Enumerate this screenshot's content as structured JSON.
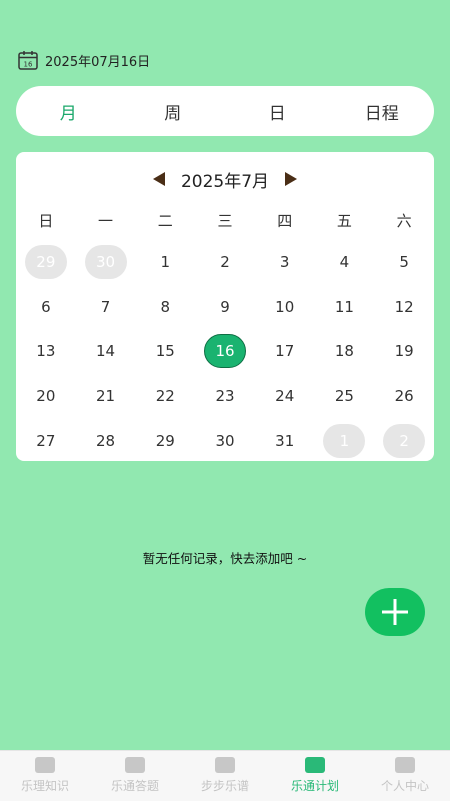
{
  "header": {
    "date": "2025年07月16日"
  },
  "view_tabs": [
    {
      "label": "月",
      "active": true
    },
    {
      "label": "周",
      "active": false
    },
    {
      "label": "日",
      "active": false
    },
    {
      "label": "日程",
      "active": false
    }
  ],
  "calendar": {
    "month_label": "2025年7月",
    "weekdays": [
      "日",
      "一",
      "二",
      "三",
      "四",
      "五",
      "六"
    ],
    "weeks": [
      [
        {
          "d": "29",
          "other": true
        },
        {
          "d": "30",
          "other": true
        },
        {
          "d": "1"
        },
        {
          "d": "2"
        },
        {
          "d": "3"
        },
        {
          "d": "4"
        },
        {
          "d": "5"
        }
      ],
      [
        {
          "d": "6"
        },
        {
          "d": "7"
        },
        {
          "d": "8"
        },
        {
          "d": "9"
        },
        {
          "d": "10"
        },
        {
          "d": "11"
        },
        {
          "d": "12"
        }
      ],
      [
        {
          "d": "13"
        },
        {
          "d": "14"
        },
        {
          "d": "15"
        },
        {
          "d": "16",
          "today": true
        },
        {
          "d": "17"
        },
        {
          "d": "18"
        },
        {
          "d": "19"
        }
      ],
      [
        {
          "d": "20"
        },
        {
          "d": "21"
        },
        {
          "d": "22"
        },
        {
          "d": "23"
        },
        {
          "d": "24"
        },
        {
          "d": "25"
        },
        {
          "d": "26"
        }
      ],
      [
        {
          "d": "27"
        },
        {
          "d": "28"
        },
        {
          "d": "29"
        },
        {
          "d": "30"
        },
        {
          "d": "31"
        },
        {
          "d": "1",
          "other": true
        },
        {
          "d": "2",
          "other": true
        }
      ]
    ]
  },
  "empty_message": "暂无任何记录，快去添加吧 ~",
  "bottom_nav": [
    {
      "label": "乐理知识",
      "icon": "music-theory-icon",
      "active": false
    },
    {
      "label": "乐通答题",
      "icon": "quiz-icon",
      "active": false
    },
    {
      "label": "步步乐谱",
      "icon": "sheet-music-icon",
      "active": false
    },
    {
      "label": "乐通计划",
      "icon": "plan-icon",
      "active": true
    },
    {
      "label": "个人中心",
      "icon": "profile-icon",
      "active": false
    }
  ],
  "colors": {
    "background": "#91e8b0",
    "accent": "#1ab370",
    "active_tab": "#1aa86a",
    "fab": "#12c060"
  }
}
